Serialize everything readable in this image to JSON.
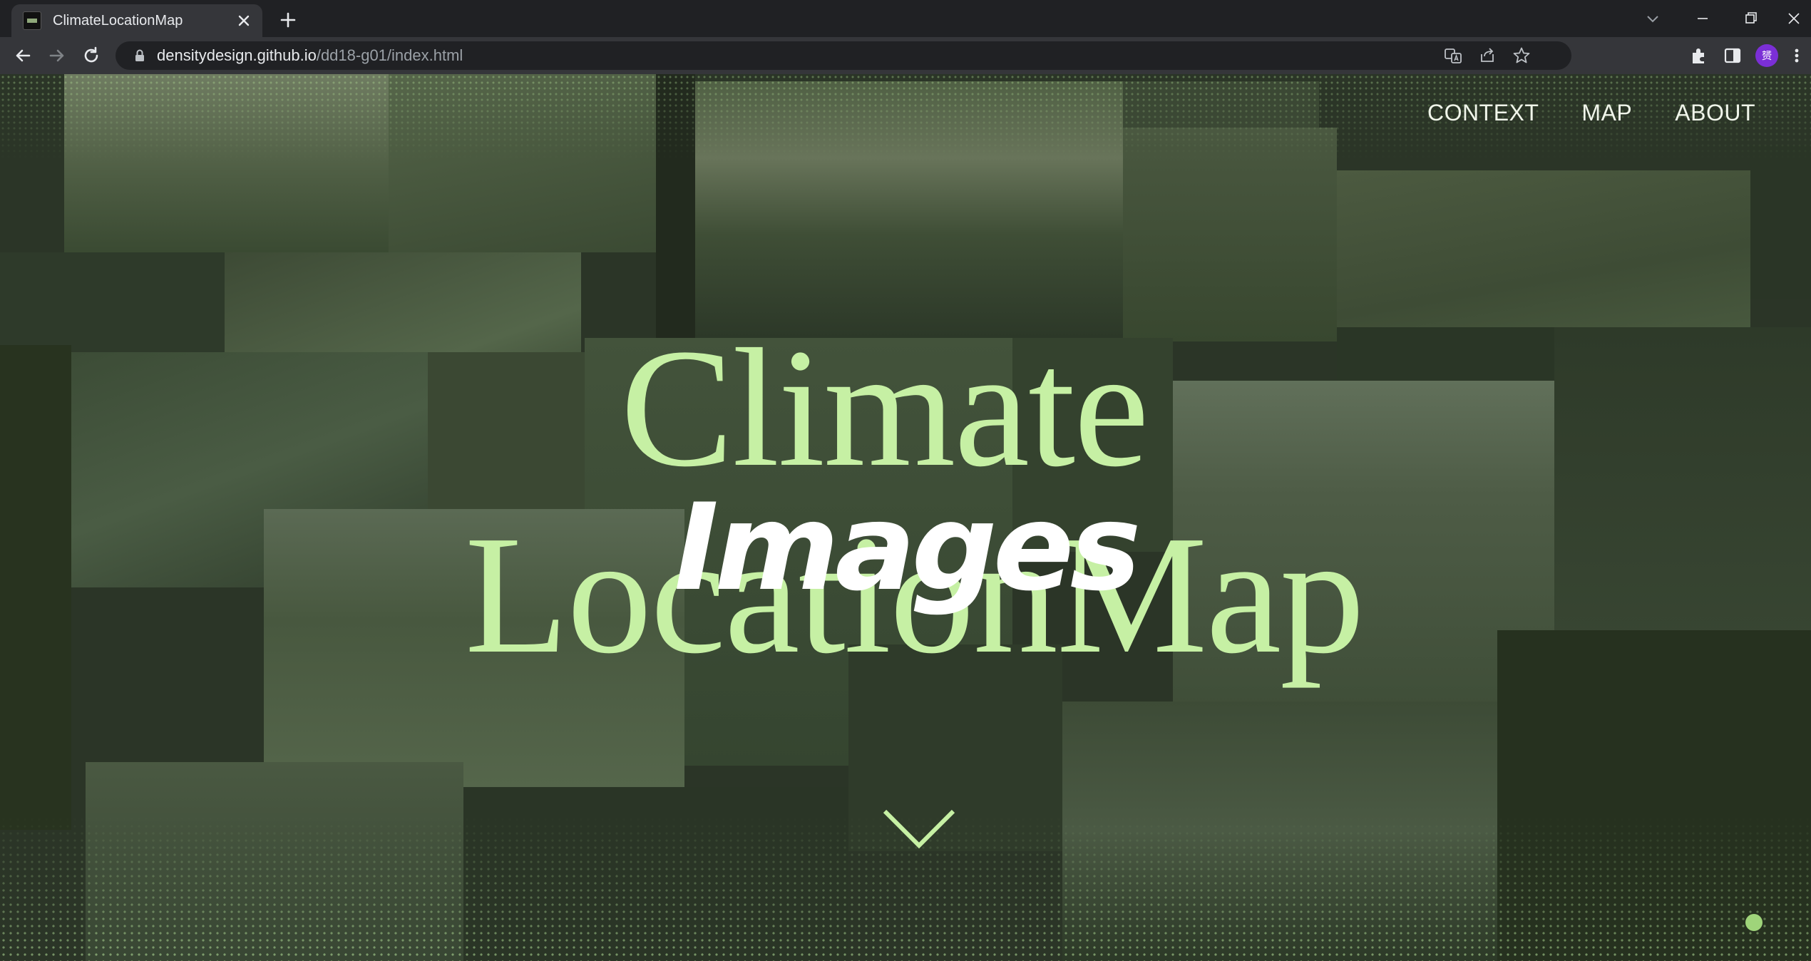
{
  "browser": {
    "tab": {
      "title": "ClimateLocationMap"
    },
    "address": {
      "host": "densitydesign.github.io",
      "path": "/dd18-g01/index.html"
    },
    "profile_initial": "赟"
  },
  "site": {
    "nav": [
      {
        "label": "CONTEXT"
      },
      {
        "label": "MAP"
      },
      {
        "label": "ABOUT"
      }
    ],
    "hero": {
      "line1": "Climate",
      "line2": "Images",
      "line3": "LocationMap"
    },
    "scroll_icon": "chevron-down-icon"
  },
  "colors": {
    "accent_green": "#c6f0a4",
    "overlay_green": "#2b3527",
    "white": "#ffffff"
  }
}
